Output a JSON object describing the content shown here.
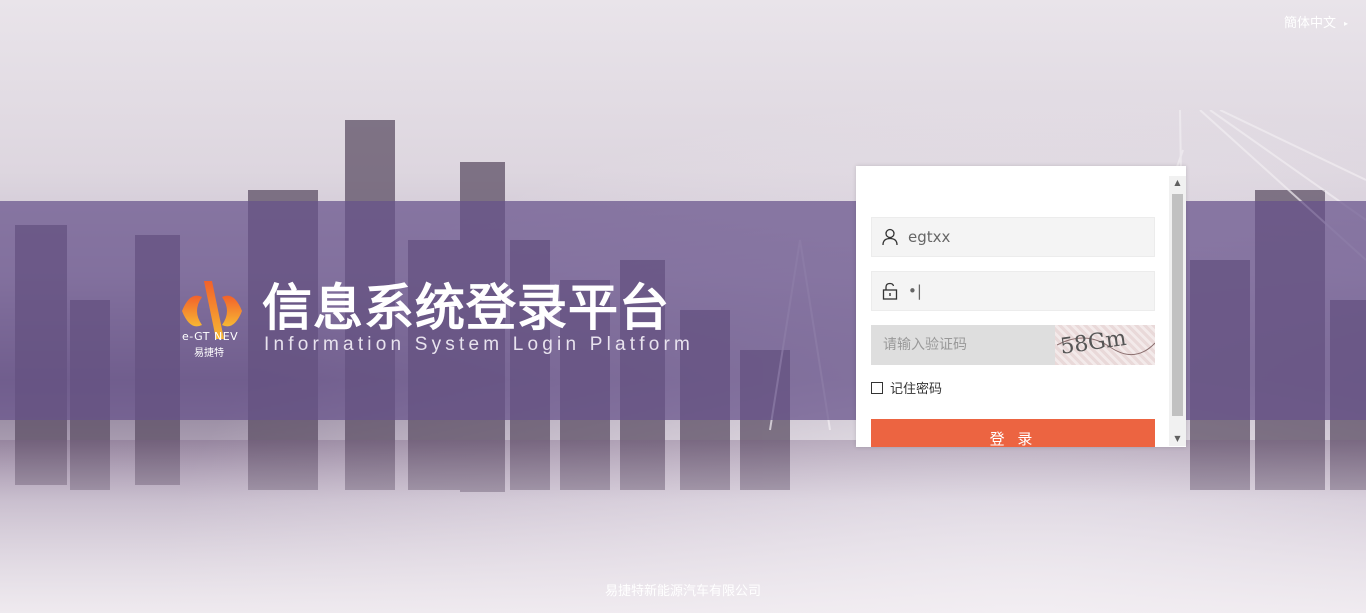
{
  "header": {
    "language_label": "簡体中文",
    "language_caret": "▸"
  },
  "brand": {
    "logo_name": "e-GT NEV",
    "logo_cn": "易捷特",
    "title_cn": "信息系统登录平台",
    "title_en": "Information System Login Platform"
  },
  "login": {
    "username_value": "egtxx",
    "password_value": "•|",
    "captcha_placeholder": "请输入验证码",
    "captcha_text": "58Gm",
    "remember_label": "记住密码",
    "login_button_label": "登 录",
    "accent_color": "#ec6441"
  },
  "footer": {
    "company": "易捷特新能源汽车有限公司"
  }
}
